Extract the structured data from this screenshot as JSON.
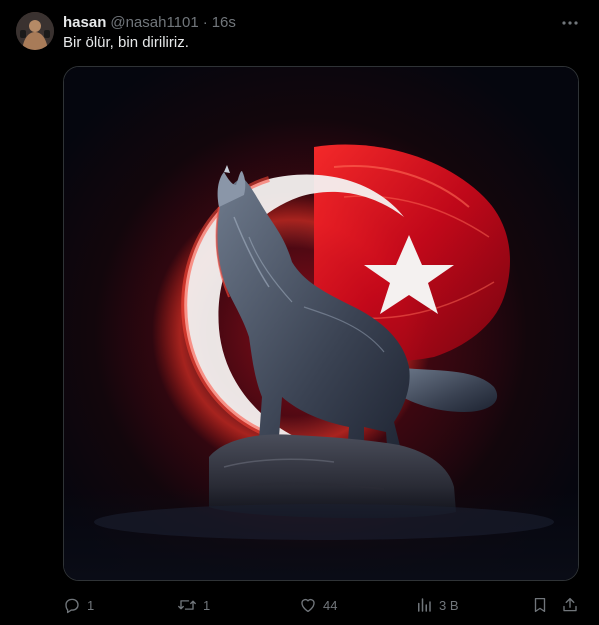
{
  "tweet": {
    "author_name": "hasan",
    "author_handle": "@nasah1101",
    "separator": "·",
    "time": "16s",
    "text": "Bir ölür, bin diriliriz.",
    "media_image": "wolf-howling-turkish-flag"
  },
  "actions": {
    "reply_count": "1",
    "retweet_count": "1",
    "like_count": "44",
    "views_count": "3 B"
  },
  "icons": {
    "more": "more-icon",
    "reply": "reply-icon",
    "retweet": "retweet-icon",
    "like": "heart-icon",
    "views": "views-icon",
    "bookmark": "bookmark-icon",
    "share": "share-icon"
  },
  "colors": {
    "background": "#000000",
    "text_primary": "#e7e9ea",
    "text_secondary": "#71767b",
    "flag_red": "#e30a17"
  }
}
